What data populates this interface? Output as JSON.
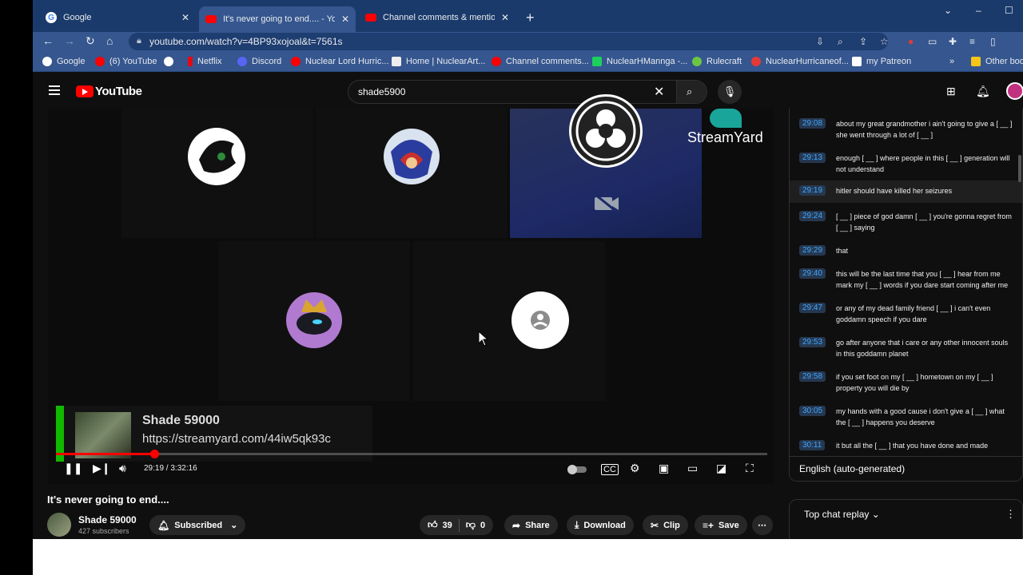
{
  "tabs": [
    {
      "title": "Google",
      "icon": "google-icon",
      "active": false
    },
    {
      "title": "It's never going to end.... - Yo",
      "icon": "youtube-icon",
      "active": true
    },
    {
      "title": "Channel comments & mentions -",
      "icon": "youtube-icon",
      "active": false
    }
  ],
  "address": {
    "url": "youtube.com/watch?v=4BP93xojoal&t=7561s"
  },
  "bookmarks": [
    "Google",
    "(6) YouTube",
    "Netflix",
    "Discord",
    "Nuclear Lord Hurric...",
    "Home | NuclearArt...",
    "Channel comments...",
    "NuclearHMannga -...",
    "Rulecraft",
    "NuclearHurricaneof...",
    "my Patreon",
    "Other boo"
  ],
  "yt": {
    "logo": "YouTube",
    "search_query": "shade5900"
  },
  "player": {
    "streamyard_label": "StreamYard",
    "lower_third_name": "Shade 59000",
    "lower_third_link": "https://streamyard.com/44iw5qk93c",
    "time": "29:19 / 3:32:16",
    "progress_fraction": 0.138
  },
  "video": {
    "title": "It's never going to end....",
    "channel": "Shade 59000",
    "subscribers": "427 subscribers",
    "subscribed_label": "Subscribed",
    "likes": "39",
    "dislikes": "0",
    "share": "Share",
    "download": "Download",
    "clip": "Clip",
    "save": "Save"
  },
  "transcript": {
    "rows": [
      {
        "time": "29:08",
        "text": "about my great grandmother i ain't going to give a [ __ ] she went through a lot of [ __ ]"
      },
      {
        "time": "29:13",
        "text": "enough [ __ ] where people in this [ __ ] generation will not understand"
      },
      {
        "time": "29:19",
        "text": "hitler should have killed her seizures"
      },
      {
        "time": "29:24",
        "text": "[ __ ] piece of god damn [ __ ] you're gonna regret from [ __ ] saying"
      },
      {
        "time": "29:29",
        "text": "that"
      },
      {
        "time": "29:40",
        "text": "this will be the last time that you [ __ ] hear from me mark my [ __ ] words if you dare start coming after me"
      },
      {
        "time": "29:47",
        "text": "or any of my dead family friend [ __ ] i can't even goddamn speech if you dare"
      },
      {
        "time": "29:53",
        "text": "go after anyone that i care or any other innocent souls in this goddamn planet"
      },
      {
        "time": "29:58",
        "text": "if you set foot on my [ __ ] hometown on my [ __ ] property you will die by"
      },
      {
        "time": "30:05",
        "text": "my hands with a good cause i don't give a [ __ ] what the [ __ ] happens you deserve"
      },
      {
        "time": "30:11",
        "text": "it but all the [ __ ] that you have done and made"
      }
    ],
    "language": "English (auto-generated)"
  },
  "chat": {
    "label": "Top chat replay"
  },
  "colors": {
    "accent": "#ff0000",
    "timestamp": "#3ea6ff",
    "green_bar": "#11b800"
  }
}
